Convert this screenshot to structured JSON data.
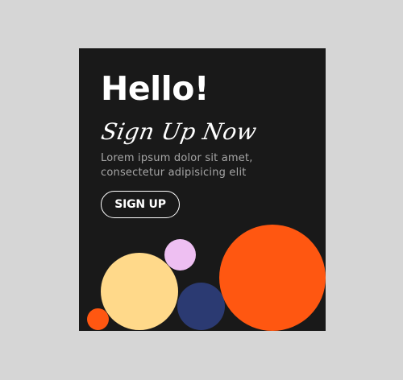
{
  "modal": {
    "title": "Hello!",
    "script_heading": "Sign Up Now",
    "body_lines": [
      "Lorem ipsum dolor sit amet,",
      "consectetur adipisicing elit"
    ],
    "button_label": "SIGN UP",
    "close_icon": "close-icon"
  },
  "colors": {
    "page_background": "#d6d6d6",
    "modal_background": "#191919",
    "text_primary": "#ffffff",
    "text_secondary": "#a6a6a6",
    "close_icon": "#8a8a8a",
    "circle_peach": "#ffd98a",
    "circle_pink": "#eebff2",
    "circle_navy": "#2b3a72",
    "circle_orange": "#ff5711",
    "circle_small_orange": "#ff5711"
  }
}
